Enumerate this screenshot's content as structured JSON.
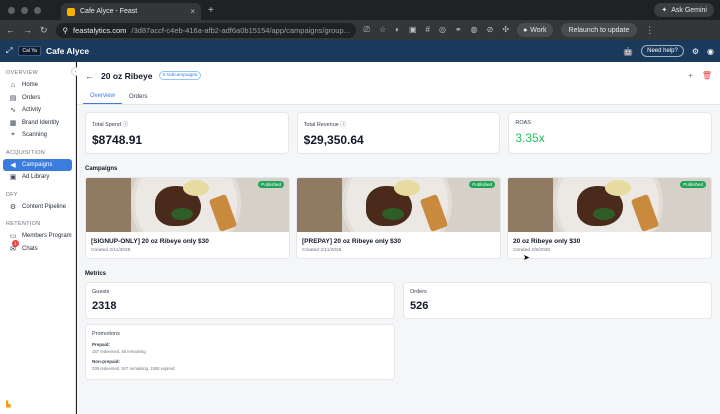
{
  "browser": {
    "tab_title": "Cafe Alyce - Feast",
    "new_tab": "+",
    "gemini": "Ask Gemini",
    "url_host": "feastalytics.com",
    "url_path": "/3d87accf-c4eb-416a-afb2-adf6a0b15154/app/campaigns/group...",
    "work_label": "Work",
    "relaunch_label": "Relaunch to update"
  },
  "header": {
    "logo_text": "Cal Ya",
    "restaurant": "Cafe Alyce",
    "help_label": "Need help?"
  },
  "sidebar": {
    "sections": [
      {
        "title": "OVERVIEW",
        "items": [
          {
            "label": "Home",
            "icon": "⌂"
          },
          {
            "label": "Orders",
            "icon": "▤"
          },
          {
            "label": "Activity",
            "icon": "∿"
          },
          {
            "label": "Brand Identity",
            "icon": "▦"
          },
          {
            "label": "Scanning",
            "icon": "⌖"
          }
        ]
      },
      {
        "title": "ACQUISITION",
        "items": [
          {
            "label": "Campaigns",
            "icon": "◀"
          },
          {
            "label": "Ad Library",
            "icon": "▣"
          }
        ]
      },
      {
        "title": "DFY",
        "items": [
          {
            "label": "Content Pipeline",
            "icon": "⚙"
          }
        ]
      },
      {
        "title": "RETENTION",
        "items": [
          {
            "label": "Members Program",
            "icon": "▭"
          },
          {
            "label": "Chats",
            "icon": "✉"
          }
        ]
      }
    ],
    "chats_badge": "1"
  },
  "page": {
    "back": "←",
    "title": "20 oz Ribeye",
    "subcampaigns": "3 subcampaigns",
    "tabs": [
      "Overview",
      "Orders"
    ]
  },
  "kpis": [
    {
      "label": "Total Spend",
      "value": "$8748.91",
      "info": "ⓘ"
    },
    {
      "label": "Total Revenue",
      "value": "$29,350.64",
      "info": "ⓘ"
    },
    {
      "label": "ROAS",
      "value": "3.35x",
      "color": "#22c55e"
    }
  ],
  "campaigns_title": "Campaigns",
  "campaigns": [
    {
      "status": "Published",
      "title": "[SIGNUP-ONLY] 20 oz Ribeye only $30",
      "created": "Created 2/11/2026"
    },
    {
      "status": "Published",
      "title": "[PREPAY] 20 oz Ribeye only $30",
      "created": "Created 2/11/2026"
    },
    {
      "status": "Published",
      "title": "20 oz Ribeye only $30",
      "created": "Created 2/9/2026"
    }
  ],
  "metrics_title": "Metrics",
  "metrics": [
    {
      "label": "Guests",
      "value": "2318"
    },
    {
      "label": "Orders",
      "value": "526"
    }
  ],
  "promotions": {
    "title": "Promotions",
    "prepaid_label": "Prepaid:",
    "prepaid_value": "157 redeemed, 46 remaining.",
    "nonprepaid_label": "Non-prepaid:",
    "nonprepaid_value": "238 redeemed, 547 remaining, 1555 expired."
  },
  "colors": {
    "accent": "#3b7ddd",
    "header": "#1a3a5c",
    "published": "#22a35a"
  }
}
